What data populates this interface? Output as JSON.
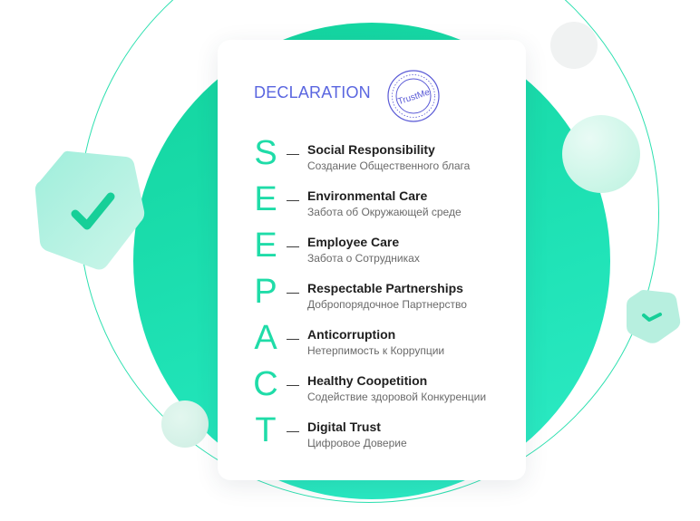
{
  "declaration": {
    "title": "DECLARATION",
    "stamp_text": "TrustMe",
    "items": [
      {
        "letter": "S",
        "title": "Social Responsibility",
        "subtitle": "Создание Общественного блага"
      },
      {
        "letter": "E",
        "title": "Environmental Care",
        "subtitle": "Забота об Окружающей среде"
      },
      {
        "letter": "E",
        "title": "Employee Care",
        "subtitle": "Забота о Сотрудниках"
      },
      {
        "letter": "P",
        "title": "Respectable Partnerships",
        "subtitle": "Добропорядочное Партнерство"
      },
      {
        "letter": "A",
        "title": "Anticorruption",
        "subtitle": "Нетерпимость к Коррупции"
      },
      {
        "letter": "C",
        "title": "Healthy Coopetition",
        "subtitle": "Содействие здоровой Конкуренции"
      },
      {
        "letter": "T",
        "title": "Digital Trust",
        "subtitle": "Цифровое Доверие"
      }
    ]
  },
  "colors": {
    "accent_green": "#1fdca8",
    "title_blue": "#5a66e0",
    "stamp_blue": "#5a5ad6"
  }
}
